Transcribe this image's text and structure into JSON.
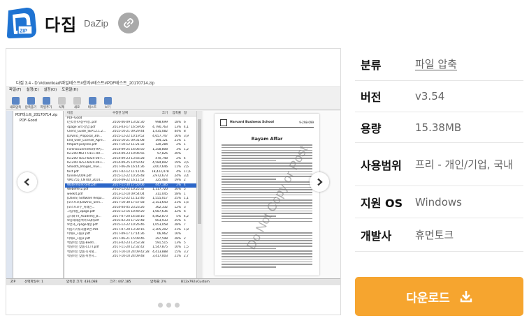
{
  "app": {
    "title": "다집",
    "subtitle": "DaZip"
  },
  "gallery": {
    "screenshot": {
      "window_title": "다집 3.4 - D:\\#download\\파일테스트#한자#테스트#PDF테스트_20170714.zip",
      "menu": [
        "파일(F)",
        "설정(E)",
        "설정(O)",
        "도움말(H)"
      ],
      "toolbar": [
        "새로압축",
        "압축풀기",
        "파일추가",
        "삭제",
        "새로",
        "테스트",
        "보기"
      ],
      "tree": [
        "PDF테스트_20170714.zip",
        "PDF-Good"
      ],
      "columns": [
        "이름",
        "수정한 날짜",
        "크기",
        "압축률",
        "형"
      ],
      "rows": [
        {
          "name": "PDF-Good",
          "date": "",
          "size": "",
          "rate": "",
          "x": ""
        },
        {
          "name": "(인터뷰)이창우(정..pdf",
          "date": "2016-06-09 13:02:30",
          "size": "998,699",
          "rate": "18%",
          "x": "6"
        },
        {
          "name": "4page 요약-끝망.pdf",
          "date": "2013-03-17 16:59:06",
          "size": "4,790,763",
          "rate": "13%",
          "x": "4,1"
        },
        {
          "name": "Client_Guide_SEP12.1.2...",
          "date": "2015-10-21 09:29:44",
          "size": "1,435,082",
          "rate": "44%",
          "x": "8"
        },
        {
          "name": "DaVinci_Proposal_34F...",
          "date": "2015-12-22 10:19:52",
          "size": "4,657,747",
          "rate": "16%",
          "x": "3,9"
        },
        {
          "name": "End_User_License_Agre...",
          "date": "2015-10-21 09:31:08",
          "size": "194,121",
          "rate": "21%",
          "x": "1"
        },
        {
          "name": "fimport-polyline.pdf",
          "date": "2017-10-12 11:21:32",
          "size": "120,284",
          "rate": "2%",
          "x": "1"
        },
        {
          "name": "Forensicunreinfor(FRP)...",
          "date": "2014-09-25 16:06:50",
          "size": "1,258,808",
          "rate": "3%",
          "x": "1,2"
        },
        {
          "name": "IS1200-MEFT-0111-00-...",
          "date": "2014-09-23 10:06:56",
          "size": "97,826",
          "rate": "20%",
          "x": ""
        },
        {
          "name": "IS1200-TE53-6024-00-F...",
          "date": "2014-09-23 13:56:28",
          "size": "470,748",
          "rate": "2%",
          "x": "4"
        },
        {
          "name": "IS1200-TE53-6024-00-F...",
          "date": "2014-09-25 10:50:42",
          "size": "4,584,892",
          "rate": "19%",
          "x": "3,6"
        },
        {
          "name": "Smooth_Images_True...",
          "date": "2017-06-26 16:14:36",
          "size": "3,007,646",
          "rate": "11%",
          "x": "2,6"
        },
        {
          "name": "test.pdf",
          "date": "2017-02-12 11:11:06",
          "size": "18,422,478",
          "rate": "4%",
          "x": "17,6"
        },
        {
          "name": "tunnler2009.pdf",
          "date": "2015-12-22 10:26:48",
          "size": "3,972,673",
          "rate": "24%",
          "x": "3,4"
        },
        {
          "name": "VM1755_CNT00_2014...",
          "date": "2014-09-22 16:11:52",
          "size": "325,464",
          "rate": "19%",
          "x": "2"
        },
        {
          "name": "Watermark-test.pdf",
          "date": "2017-11-30 17:50:06",
          "size": "447,185",
          "rate": "2%",
          "x": "4",
          "selected": true
        },
        {
          "name": "Webeffer2.pdf",
          "date": "2015-12-22 10:25:32",
          "size": "1,117,720",
          "rate": "50%",
          "x": "5"
        },
        {
          "name": "weeklt.pdf",
          "date": "2013-12-10 09:54:04",
          "size": "311,045",
          "rate": "58%",
          "x": "1"
        },
        {
          "name": "[DaviS] Software Requi...",
          "date": "2015-12-22 11:12:46",
          "size": "1,555,017",
          "rate": "25%",
          "x": "1,1"
        },
        {
          "name": "[포스트모]DaVinci_Serv...",
          "date": "2017-10-30 17:57:58",
          "size": "2,151,643",
          "rate": "21%",
          "x": "1,6"
        },
        {
          "name": "[포스트모두_미래인...",
          "date": "2014-04-05 23:23:26",
          "size": "362,332",
          "rate": "12%",
          "x": "3"
        },
        {
          "name": "그림개정_3page.pdf",
          "date": "2015-12-16 10:49:20",
          "size": "1,087,636",
          "rate": "32%",
          "x": "6"
        },
        {
          "name": "금지와TV_Academy_B...",
          "date": "2017-07-20 14:58:16",
          "size": "4,462,873",
          "rate": "5%",
          "x": "4,2"
        },
        {
          "name": "보증재해칭책서-LQP.pdf",
          "date": "2015-02-24 17:22:48",
          "size": "603,933",
          "rate": "25%",
          "x": "5"
        },
        {
          "name": "보존과_2page개정.pdf",
          "date": "2015-12-22 10:26:46",
          "size": "1,053,058",
          "rate": "28%",
          "x": "7"
        },
        {
          "name": "이동기기류처홍보안.PDF",
          "date": "2017-07-20 13:39:16",
          "size": "2,305,202",
          "rate": "21%",
          "x": "1,8"
        },
        {
          "name": "이태호_지원2.pdf",
          "date": "2017-09-17 17:14:36",
          "size": "66,962",
          "rate": "16%",
          "x": ""
        },
        {
          "name": "이태호_지원2.pdf",
          "date": "2017-06-21 15:09:46",
          "size": "297,598",
          "rate": "28%",
          "x": "2"
        },
        {
          "name": "엑실이인 맞춤-Beetl...",
          "date": "2013-02-23 13:53:38",
          "size": "591,515",
          "rate": "13%",
          "x": "5"
        },
        {
          "name": "엑실이인 맞춤-CCTT.pdf",
          "date": "2017-11-20 12:32:42",
          "size": "1,547,875",
          "rate": "10%",
          "x": "1,5"
        },
        {
          "name": "엑실이인 맞춤-디지털...",
          "date": "2017-10-10 24:09:42:28",
          "size": "4,413,888",
          "rate": "15%",
          "x": "3,7"
        },
        {
          "name": "엑실이인 맞춤-이번지...",
          "date": "2017-10-10 24:09:48",
          "size": "3,417,003",
          "rate": "21%",
          "x": "2,7"
        }
      ],
      "preview": {
        "school": "Harvard Business School",
        "page_no": "9-298-099",
        "case_title": "Rayam Affar",
        "watermark": "Do Not Copy or Post"
      },
      "status": {
        "selected": "선택파일수: 1",
        "size": "압축후 크기: 436,088",
        "original": "크기: 447,185",
        "ratio": "압축률: 2%",
        "method": "B12x792xCustom"
      }
    },
    "dot_count": 3
  },
  "info": {
    "rows": [
      {
        "label": "분류",
        "value": "파일 압축"
      },
      {
        "label": "버전",
        "value": "v3.54"
      },
      {
        "label": "용량",
        "value": "15.38MB"
      },
      {
        "label": "사용범위",
        "value": "프리 - 개인/기업, 국내"
      },
      {
        "label": "지원 OS",
        "value": "Windows"
      },
      {
        "label": "개발사",
        "value": "휴먼토크"
      }
    ]
  },
  "download": {
    "label": "다운로드"
  },
  "colors": {
    "accent": "#f6a52f",
    "logo_blue": "#1e73d2",
    "selection": "#2c66c8"
  }
}
